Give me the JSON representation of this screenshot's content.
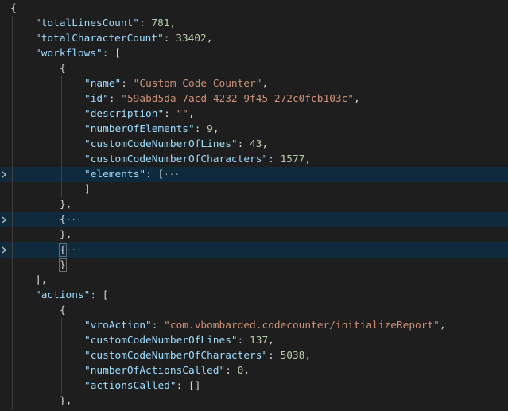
{
  "lines": [
    {
      "indent": 0,
      "tokens": [
        {
          "t": "p",
          "v": "{"
        }
      ]
    },
    {
      "indent": 1,
      "tokens": [
        {
          "t": "k",
          "v": "\"totalLinesCount\""
        },
        {
          "t": "p",
          "v": ": "
        },
        {
          "t": "n",
          "v": "781"
        },
        {
          "t": "p",
          "v": ","
        }
      ]
    },
    {
      "indent": 1,
      "tokens": [
        {
          "t": "k",
          "v": "\"totalCharacterCount\""
        },
        {
          "t": "p",
          "v": ": "
        },
        {
          "t": "n",
          "v": "33402"
        },
        {
          "t": "p",
          "v": ","
        }
      ]
    },
    {
      "indent": 1,
      "tokens": [
        {
          "t": "k",
          "v": "\"workflows\""
        },
        {
          "t": "p",
          "v": ": ["
        }
      ]
    },
    {
      "indent": 2,
      "tokens": [
        {
          "t": "p",
          "v": "{"
        }
      ]
    },
    {
      "indent": 3,
      "tokens": [
        {
          "t": "k",
          "v": "\"name\""
        },
        {
          "t": "p",
          "v": ": "
        },
        {
          "t": "s",
          "v": "\"Custom Code Counter\""
        },
        {
          "t": "p",
          "v": ","
        }
      ]
    },
    {
      "indent": 3,
      "tokens": [
        {
          "t": "k",
          "v": "\"id\""
        },
        {
          "t": "p",
          "v": ": "
        },
        {
          "t": "s",
          "v": "\"59abd5da-7acd-4232-9f45-272c0fcb103c\""
        },
        {
          "t": "p",
          "v": ","
        }
      ]
    },
    {
      "indent": 3,
      "tokens": [
        {
          "t": "k",
          "v": "\"description\""
        },
        {
          "t": "p",
          "v": ": "
        },
        {
          "t": "s",
          "v": "\"\""
        },
        {
          "t": "p",
          "v": ","
        }
      ]
    },
    {
      "indent": 3,
      "tokens": [
        {
          "t": "k",
          "v": "\"numberOfElements\""
        },
        {
          "t": "p",
          "v": ": "
        },
        {
          "t": "n",
          "v": "9"
        },
        {
          "t": "p",
          "v": ","
        }
      ]
    },
    {
      "indent": 3,
      "tokens": [
        {
          "t": "k",
          "v": "\"customCodeNumberOfLines\""
        },
        {
          "t": "p",
          "v": ": "
        },
        {
          "t": "n",
          "v": "43"
        },
        {
          "t": "p",
          "v": ","
        }
      ]
    },
    {
      "indent": 3,
      "tokens": [
        {
          "t": "k",
          "v": "\"customCodeNumberOfCharacters\""
        },
        {
          "t": "p",
          "v": ": "
        },
        {
          "t": "n",
          "v": "1577"
        },
        {
          "t": "p",
          "v": ","
        }
      ]
    },
    {
      "indent": 3,
      "folded": true,
      "highlight": true,
      "tokens": [
        {
          "t": "k",
          "v": "\"elements\""
        },
        {
          "t": "p",
          "v": ": ["
        },
        {
          "t": "ell",
          "v": "···"
        }
      ]
    },
    {
      "indent": 3,
      "tokens": [
        {
          "t": "p",
          "v": "]"
        }
      ]
    },
    {
      "indent": 2,
      "tokens": [
        {
          "t": "p",
          "v": "},"
        }
      ]
    },
    {
      "indent": 2,
      "folded": true,
      "highlight": true,
      "tokens": [
        {
          "t": "p",
          "v": "{"
        },
        {
          "t": "ell",
          "v": "···"
        }
      ]
    },
    {
      "indent": 2,
      "tokens": [
        {
          "t": "p",
          "v": "},"
        }
      ]
    },
    {
      "indent": 2,
      "folded": true,
      "highlight": true,
      "bracketMatch": true,
      "tokens": [
        {
          "t": "p",
          "v": "{"
        },
        {
          "t": "ell",
          "v": "···"
        }
      ]
    },
    {
      "indent": 2,
      "bracketMatch": true,
      "tokens": [
        {
          "t": "p",
          "v": "}"
        }
      ]
    },
    {
      "indent": 1,
      "tokens": [
        {
          "t": "p",
          "v": "],"
        }
      ]
    },
    {
      "indent": 1,
      "tokens": [
        {
          "t": "k",
          "v": "\"actions\""
        },
        {
          "t": "p",
          "v": ": ["
        }
      ]
    },
    {
      "indent": 2,
      "tokens": [
        {
          "t": "p",
          "v": "{"
        }
      ]
    },
    {
      "indent": 3,
      "tokens": [
        {
          "t": "k",
          "v": "\"vroAction\""
        },
        {
          "t": "p",
          "v": ": "
        },
        {
          "t": "s",
          "v": "\"com.vbombarded.codecounter/initializeReport\""
        },
        {
          "t": "p",
          "v": ","
        }
      ]
    },
    {
      "indent": 3,
      "tokens": [
        {
          "t": "k",
          "v": "\"customCodeNumberOfLines\""
        },
        {
          "t": "p",
          "v": ": "
        },
        {
          "t": "n",
          "v": "137"
        },
        {
          "t": "p",
          "v": ","
        }
      ]
    },
    {
      "indent": 3,
      "tokens": [
        {
          "t": "k",
          "v": "\"customCodeNumberOfCharacters\""
        },
        {
          "t": "p",
          "v": ": "
        },
        {
          "t": "n",
          "v": "5038"
        },
        {
          "t": "p",
          "v": ","
        }
      ]
    },
    {
      "indent": 3,
      "tokens": [
        {
          "t": "k",
          "v": "\"numberOfActionsCalled\""
        },
        {
          "t": "p",
          "v": ": "
        },
        {
          "t": "n",
          "v": "0"
        },
        {
          "t": "p",
          "v": ","
        }
      ]
    },
    {
      "indent": 3,
      "tokens": [
        {
          "t": "k",
          "v": "\"actionsCalled\""
        },
        {
          "t": "p",
          "v": ": []"
        }
      ]
    },
    {
      "indent": 2,
      "tokens": [
        {
          "t": "p",
          "v": "},"
        }
      ]
    }
  ],
  "colors": {
    "background": "#1e1e1e",
    "key": "#9cdcfe",
    "string": "#ce9178",
    "number": "#b5cea8",
    "punctuation": "#d4d4d4",
    "foldedLineHighlight": "#0e2a3c"
  },
  "icons": {
    "fold": "chevron-right-icon"
  }
}
